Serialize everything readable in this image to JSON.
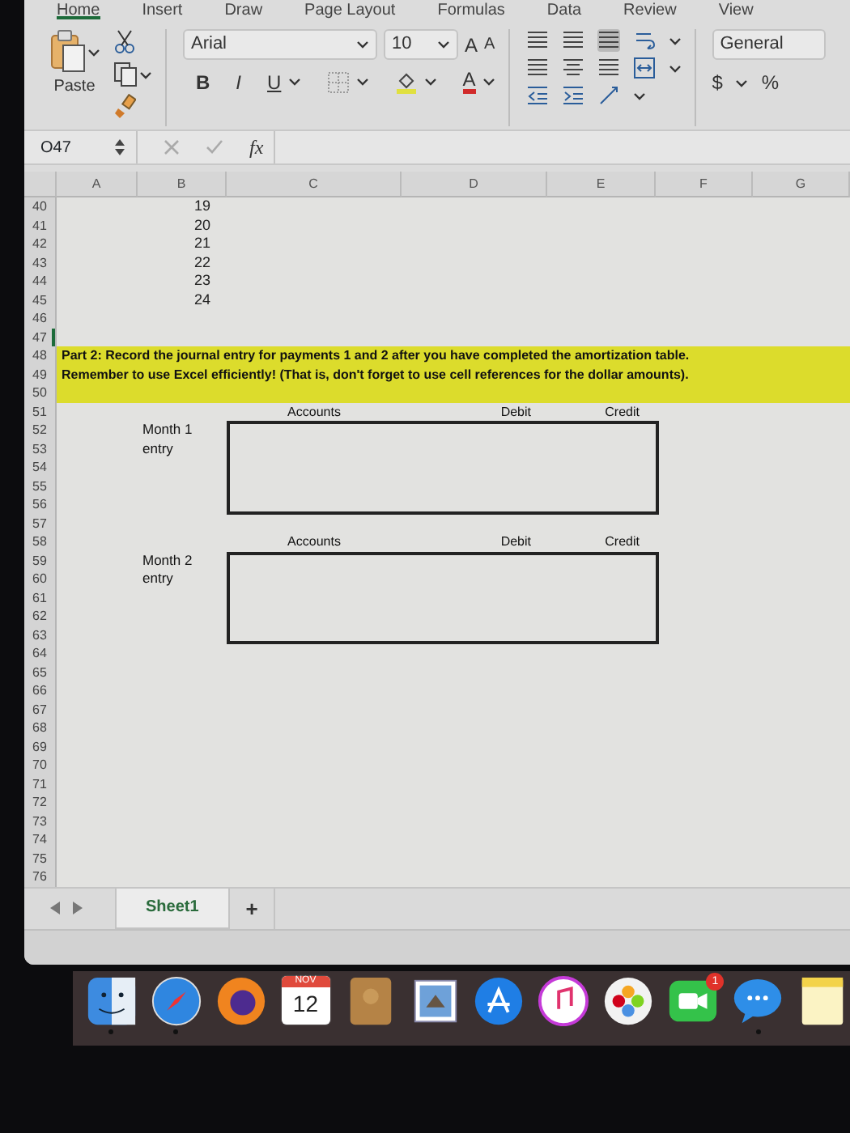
{
  "ribbon_tabs": [
    {
      "label": "Home",
      "selected": true
    },
    {
      "label": "Insert",
      "selected": false
    },
    {
      "label": "Draw",
      "selected": false
    },
    {
      "label": "Page Layout",
      "selected": false
    },
    {
      "label": "Formulas",
      "selected": false
    },
    {
      "label": "Data",
      "selected": false
    },
    {
      "label": "Review",
      "selected": false
    },
    {
      "label": "View",
      "selected": false
    }
  ],
  "toolbar": {
    "paste_label": "Paste",
    "font_name": "Arial",
    "font_size": "10",
    "grow_font": "A",
    "shrink_font": "A",
    "bold": "B",
    "italic": "I",
    "underline": "U",
    "font_color": "A",
    "number_format": "General",
    "currency": "$",
    "percent": "%"
  },
  "formula_bar": {
    "name_box": "O47",
    "function_label": "fx"
  },
  "columns": [
    "A",
    "B",
    "C",
    "D",
    "E",
    "F",
    "G"
  ],
  "rows": [
    {
      "number": "40",
      "b": "19"
    },
    {
      "number": "41",
      "b": "20"
    },
    {
      "number": "42",
      "b": "21"
    },
    {
      "number": "43",
      "b": "22"
    },
    {
      "number": "44",
      "b": "23"
    },
    {
      "number": "45",
      "b": "24"
    },
    {
      "number": "46"
    },
    {
      "number": "47",
      "active": true
    },
    {
      "number": "48",
      "highlighted": true,
      "text": "Part 2:  Record the journal entry for payments 1 and 2 after you have completed the amortization table."
    },
    {
      "number": "49",
      "highlighted": true,
      "text": "Remember to use Excel efficiently!  (That is, don't forget to use cell references for the dollar amounts)."
    },
    {
      "number": "50",
      "highlighted": true
    },
    {
      "number": "51"
    },
    {
      "number": "52"
    },
    {
      "number": "53"
    },
    {
      "number": "54"
    },
    {
      "number": "55"
    },
    {
      "number": "56"
    },
    {
      "number": "57"
    },
    {
      "number": "58"
    },
    {
      "number": "59"
    },
    {
      "number": "60"
    },
    {
      "number": "61"
    },
    {
      "number": "62"
    },
    {
      "number": "63"
    },
    {
      "number": "64"
    },
    {
      "number": "65"
    },
    {
      "number": "66"
    },
    {
      "number": "67"
    },
    {
      "number": "68"
    },
    {
      "number": "69"
    },
    {
      "number": "70"
    },
    {
      "number": "71"
    },
    {
      "number": "72"
    },
    {
      "number": "73"
    },
    {
      "number": "74"
    },
    {
      "number": "75"
    },
    {
      "number": "76"
    }
  ],
  "journal_entries": [
    {
      "label": "Month 1 entry",
      "headers": [
        "Accounts",
        "Debit",
        "Credit"
      ]
    },
    {
      "label": "Month 2 entry",
      "headers": [
        "Accounts",
        "Debit",
        "Credit"
      ]
    }
  ],
  "sheet_tabs": [
    {
      "label": "Sheet1",
      "selected": true
    }
  ],
  "add_sheet": "+",
  "dock": [
    {
      "kind": "finder",
      "running": true
    },
    {
      "kind": "safari",
      "running": true
    },
    {
      "kind": "firefox",
      "running": false
    },
    {
      "kind": "calendar",
      "running": false,
      "month": "NOV",
      "day": "12"
    },
    {
      "kind": "contacts",
      "running": false
    },
    {
      "kind": "mail",
      "running": false
    },
    {
      "kind": "appstore",
      "running": false
    },
    {
      "kind": "music",
      "running": false
    },
    {
      "kind": "photos",
      "running": false
    },
    {
      "kind": "facetime",
      "running": false,
      "badge": "1"
    },
    {
      "kind": "messages",
      "running": true
    },
    {
      "kind": "notes",
      "running": false
    }
  ]
}
